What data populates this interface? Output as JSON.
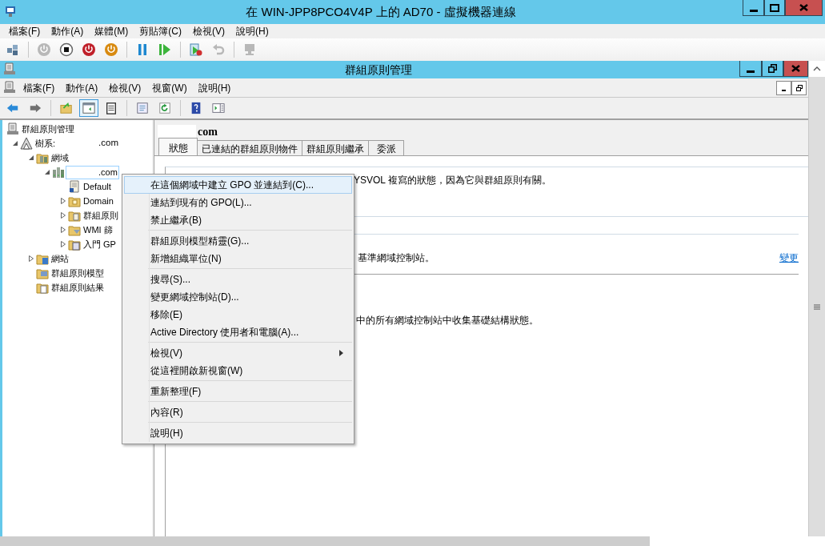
{
  "vm_window": {
    "title": "在 WIN-JPP8PCO4V4P 上的 AD70 - 虛擬機器連線",
    "menu": [
      "檔案(F)",
      "動作(A)",
      "媒體(M)",
      "剪貼簿(C)",
      "檢視(V)",
      "說明(H)"
    ],
    "toolbar": [
      [
        {
          "kind": "keys",
          "disabled": false
        }
      ],
      [
        {
          "kind": "power",
          "disabled": true
        },
        {
          "kind": "stop",
          "disabled": false
        },
        {
          "kind": "shutdown",
          "disabled": false
        },
        {
          "kind": "save",
          "disabled": false
        }
      ],
      [
        {
          "kind": "pause",
          "disabled": false
        },
        {
          "kind": "play",
          "disabled": false
        }
      ],
      [
        {
          "kind": "film",
          "disabled": false
        },
        {
          "kind": "undo",
          "disabled": true
        }
      ],
      [
        {
          "kind": "monitor",
          "disabled": true
        }
      ]
    ]
  },
  "gpmc_window": {
    "title": "群組原則管理",
    "menu": [
      "檔案(F)",
      "動作(A)",
      "檢視(V)",
      "視窗(W)",
      "說明(H)"
    ],
    "toolbar": [
      [
        {
          "kind": "back",
          "pressed": false
        },
        {
          "kind": "forward",
          "pressed": false
        }
      ],
      [
        {
          "kind": "up-folder",
          "pressed": false
        },
        {
          "kind": "panel",
          "pressed": true
        },
        {
          "kind": "clipboard",
          "pressed": false
        }
      ],
      [
        {
          "kind": "list",
          "pressed": false
        },
        {
          "kind": "refresh",
          "pressed": false
        }
      ],
      [
        {
          "kind": "help",
          "pressed": false
        },
        {
          "kind": "action-pane",
          "pressed": false
        }
      ]
    ]
  },
  "tree": [
    {
      "kind": "console",
      "label": "群組原則管理",
      "selected": false,
      "children": [
        {
          "kind": "forest",
          "label": "樹系:",
          "suffix": ".com",
          "selected": false,
          "expanded": true,
          "children": [
            {
              "kind": "domains",
              "label": "網域",
              "selected": false,
              "expanded": true,
              "children": [
                {
                  "kind": "domain",
                  "label": ".com",
                  "redacted": true,
                  "selected": true,
                  "expanded": true,
                  "children": [
                    {
                      "kind": "gpo-link",
                      "label": "Default",
                      "selected": false
                    },
                    {
                      "kind": "ou",
                      "label": "Domain",
                      "selected": false,
                      "expanded": false
                    },
                    {
                      "kind": "gpo-folder",
                      "label": "群組原則",
                      "selected": false,
                      "expanded": false
                    },
                    {
                      "kind": "wmi",
                      "label": "WMI 篩",
                      "selected": false,
                      "expanded": false
                    },
                    {
                      "kind": "starter",
                      "label": "入門 GP",
                      "selected": false,
                      "expanded": false
                    }
                  ]
                }
              ]
            },
            {
              "kind": "sites",
              "label": "網站",
              "selected": false,
              "expanded": false
            },
            {
              "kind": "modeling",
              "label": "群組原則模型",
              "selected": false
            },
            {
              "kind": "results",
              "label": "群組原則結果",
              "selected": false
            }
          ]
        }
      ]
    }
  ],
  "details": {
    "title": "com",
    "redacted": true,
    "tabs": [
      {
        "label": "狀態",
        "selected": true
      },
      {
        "label": "已連結的群組原則物件",
        "selected": false
      },
      {
        "label": "群組原則繼承",
        "selected": false
      },
      {
        "label": "委派",
        "selected": false
      }
    ],
    "sections": [
      {
        "text": "YSVOL 複寫的狀態，因為它與群組原則有關。"
      },
      {
        "text": "基準網域控制站。",
        "link": "變更"
      },
      {
        "text": "中的所有網域控制站中收集基礎結構狀態。"
      }
    ]
  },
  "context_menu": {
    "groups": [
      [
        {
          "label": "在這個網域中建立 GPO 並連結到(C)...",
          "selected": true,
          "submenu": false
        },
        {
          "label": "連結到現有的 GPO(L)...",
          "selected": false,
          "submenu": false
        },
        {
          "label": "禁止繼承(B)",
          "selected": false,
          "submenu": false
        }
      ],
      [
        {
          "label": "群組原則模型精靈(G)...",
          "selected": false,
          "submenu": false
        },
        {
          "label": "新增組織單位(N)",
          "selected": false,
          "submenu": false
        }
      ],
      [
        {
          "label": "搜尋(S)...",
          "selected": false,
          "submenu": false
        },
        {
          "label": "變更網域控制站(D)...",
          "selected": false,
          "submenu": false
        },
        {
          "label": "移除(E)",
          "selected": false,
          "submenu": false
        },
        {
          "label": "Active Directory 使用者和電腦(A)...",
          "selected": false,
          "submenu": false
        }
      ],
      [
        {
          "label": "檢視(V)",
          "selected": false,
          "submenu": true
        },
        {
          "label": "從這裡開啟新視窗(W)",
          "selected": false,
          "submenu": false
        }
      ],
      [
        {
          "label": "重新整理(F)",
          "selected": false,
          "submenu": false
        }
      ],
      [
        {
          "label": "內容(R)",
          "selected": false,
          "submenu": false
        }
      ],
      [
        {
          "label": "說明(H)",
          "selected": false,
          "submenu": false
        }
      ]
    ]
  }
}
